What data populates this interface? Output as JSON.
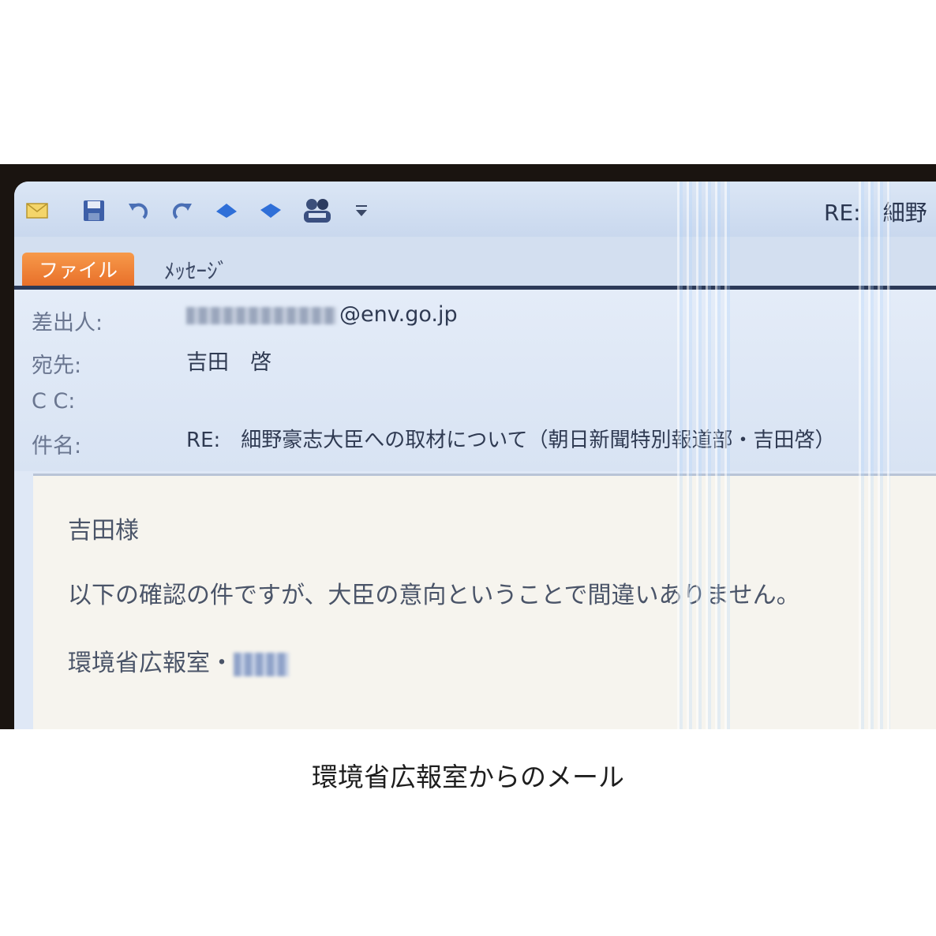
{
  "window": {
    "title": "RE:　細野"
  },
  "toolbar": {
    "icons": [
      "envelope-icon",
      "save-icon",
      "undo-icon",
      "redo-icon",
      "previous-item-icon",
      "next-item-icon",
      "people-icon",
      "customize-dropdown-icon"
    ]
  },
  "tabs": {
    "file_label": "ファイル",
    "message_label": "ﾒｯｾｰｼﾞ"
  },
  "headers": {
    "from_label": "差出人:",
    "from_value": "@env.go.jp",
    "to_label": "宛先:",
    "to_value": "吉田　啓",
    "cc_label": "C C:",
    "subject_label": "件名:",
    "subject_value": "RE:　細野豪志大臣への取材について（朝日新聞特別報道部・吉田啓）"
  },
  "body": {
    "greeting": "吉田様",
    "text": "以下の確認の件ですが、大臣の意向ということで間違いありません。",
    "signature": "環境省広報室・"
  },
  "caption": "環境省広報室からのメール",
  "colors": {
    "file_tab": "#e8702a",
    "screen_bg": "#dfe8f6",
    "body_bg": "#f6f4ee"
  }
}
